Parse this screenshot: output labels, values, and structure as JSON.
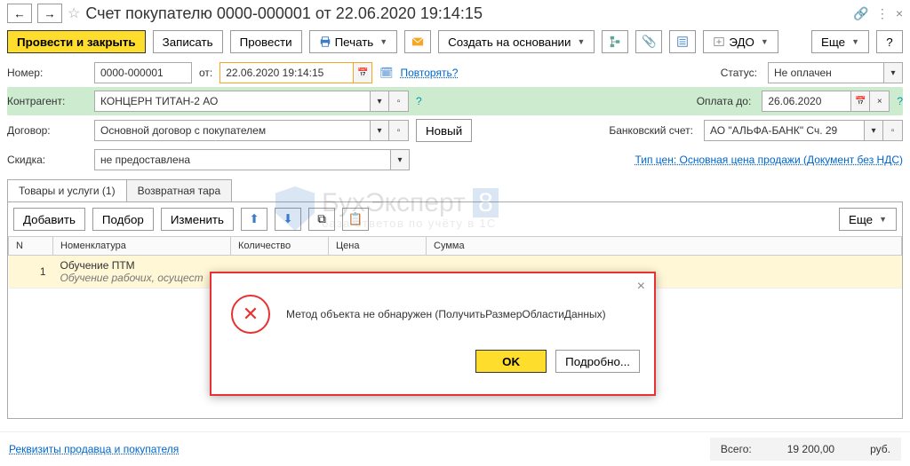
{
  "title": "Счет покупателю 0000-000001 от 22.06.2020 19:14:15",
  "toolbar": {
    "post_close": "Провести и закрыть",
    "save": "Записать",
    "post": "Провести",
    "print": "Печать",
    "create_based": "Создать на основании",
    "edo": "ЭДО",
    "more": "Еще",
    "help": "?"
  },
  "fields": {
    "number_label": "Номер:",
    "number": "0000-000001",
    "from_label": "от:",
    "date": "22.06.2020 19:14:15",
    "repeat": "Повторять?",
    "status_label": "Статус:",
    "status": "Не оплачен",
    "counterparty_label": "Контрагент:",
    "counterparty": "КОНЦЕРН ТИТАН-2 АО",
    "payment_until_label": "Оплата до:",
    "payment_until": "26.06.2020",
    "contract_label": "Договор:",
    "contract": "Основной договор с покупателем",
    "new_btn": "Новый",
    "bank_account_label": "Банковский счет:",
    "bank_account": "АО \"АЛЬФА-БАНК\" Сч. 29",
    "discount_label": "Скидка:",
    "discount": "не предоставлена",
    "price_type": "Тип цен: Основная цена продажи (Документ без НДС)"
  },
  "tabs": {
    "goods": "Товары и услуги (1)",
    "tare": "Возвратная тара"
  },
  "tab_toolbar": {
    "add": "Добавить",
    "pick": "Подбор",
    "edit": "Изменить",
    "more": "Еще"
  },
  "columns": {
    "n": "N",
    "nomenclature": "Номенклатура",
    "qty": "Количество",
    "price": "Цена",
    "sum": "Сумма"
  },
  "rows": [
    {
      "n": "1",
      "name": "Обучение ПТМ",
      "sub": "Обучение рабочих, осущест"
    }
  ],
  "dialog": {
    "message": "Метод объекта не обнаружен (ПолучитьРазмерОбластиДанных)",
    "ok": "OK",
    "details": "Подробно..."
  },
  "footer": {
    "link": "Реквизиты продавца и покупателя",
    "total_label": "Всего:",
    "total": "19 200,00",
    "currency": "руб."
  },
  "watermark": {
    "main": "БухЭксперт",
    "box": "8",
    "sub": "база ответов по учёту в 1С"
  }
}
